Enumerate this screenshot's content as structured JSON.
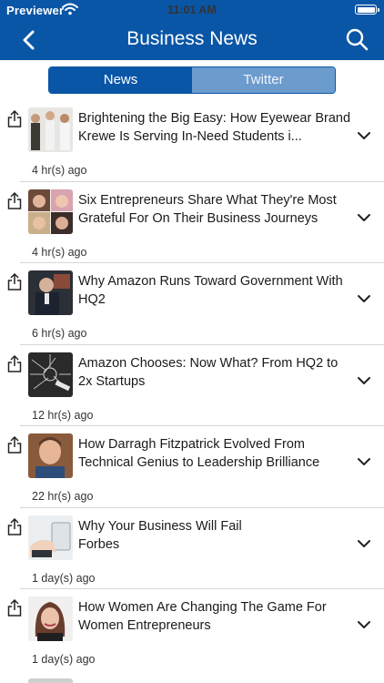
{
  "status_bar": {
    "carrier": "Previewer",
    "time": "11:01 AM"
  },
  "header": {
    "title": "Business News",
    "back_icon": "chevron-left-icon",
    "search_icon": "search-icon"
  },
  "tabs": [
    {
      "label": "News",
      "active": true
    },
    {
      "label": "Twitter",
      "active": false
    }
  ],
  "articles": [
    {
      "headline": "Brightening the Big Easy: How Eyewear Brand Krewe Is Serving In-Need Students i...",
      "time": "4 hr(s) ago"
    },
    {
      "headline": "Six Entrepreneurs Share What They're Most Grateful For On Their Business Journeys",
      "time": "4 hr(s) ago"
    },
    {
      "headline": "Why Amazon Runs Toward Government With HQ2",
      "time": "6 hr(s) ago"
    },
    {
      "headline": "Amazon Chooses: Now What? From HQ2 to 2x Startups",
      "time": "12 hr(s) ago"
    },
    {
      "headline": "How Darragh Fitzpatrick Evolved From Technical Genius to Leadership Brilliance",
      "time": "22 hr(s) ago"
    },
    {
      "headline": "Why Your Business Will Fail\nForbes",
      "time": "1 day(s) ago"
    },
    {
      "headline": "How Women Are Changing The Game For Women Entrepreneurs",
      "time": "1 day(s) ago"
    }
  ],
  "colors": {
    "brand": "#0a56a6",
    "tab_inactive": "#6c9bce",
    "divider": "#d6d6d6"
  }
}
